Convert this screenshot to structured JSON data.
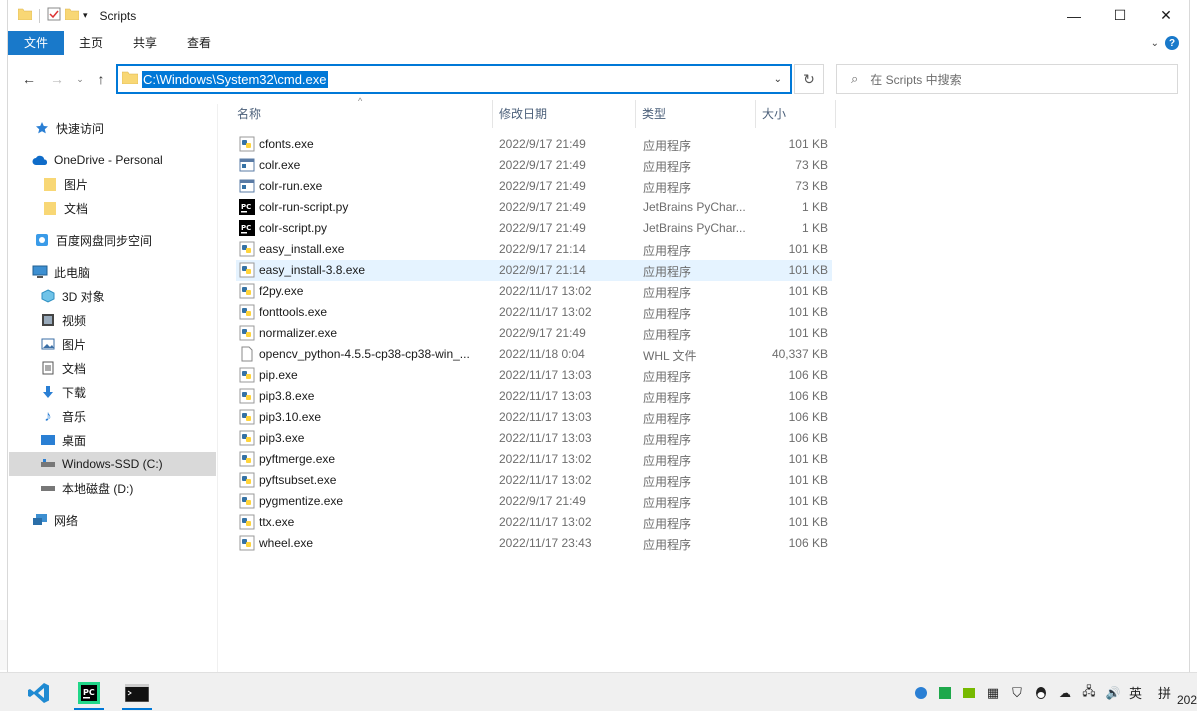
{
  "window": {
    "title": "Scripts",
    "controls": {
      "minimize": "—",
      "maximize": "☐",
      "close": "✕"
    }
  },
  "ribbon": {
    "tabs": [
      {
        "label": "文件",
        "active": true
      },
      {
        "label": "主页",
        "active": false
      },
      {
        "label": "共享",
        "active": false
      },
      {
        "label": "查看",
        "active": false
      }
    ],
    "help": "?"
  },
  "navigation": {
    "address": "C:\\Windows\\System32\\cmd.exe",
    "search_placeholder": "在 Scripts 中搜索"
  },
  "sidebar": {
    "items": [
      {
        "label": "快速访问",
        "icon": "star-icon"
      },
      {
        "label": "OneDrive - Personal",
        "icon": "cloud-icon"
      },
      {
        "label": "图片",
        "icon": "folder-icon"
      },
      {
        "label": "文档",
        "icon": "folder-icon"
      },
      {
        "label": "百度网盘同步空间",
        "icon": "baidu-netdisk-icon"
      },
      {
        "label": "此电脑",
        "icon": "computer-icon"
      },
      {
        "label": "3D 对象",
        "icon": "cube-icon"
      },
      {
        "label": "视频",
        "icon": "video-icon"
      },
      {
        "label": "图片",
        "icon": "pictures-icon"
      },
      {
        "label": "文档",
        "icon": "document-icon"
      },
      {
        "label": "下载",
        "icon": "download-icon"
      },
      {
        "label": "音乐",
        "icon": "music-icon"
      },
      {
        "label": "桌面",
        "icon": "desktop-icon"
      },
      {
        "label": "Windows-SSD (C:)",
        "icon": "drive-icon",
        "selected": true
      },
      {
        "label": "本地磁盘 (D:)",
        "icon": "drive-icon"
      },
      {
        "label": "网络",
        "icon": "network-icon"
      }
    ]
  },
  "columns": {
    "name": "名称",
    "modified": "修改日期",
    "type": "类型",
    "size": "大小"
  },
  "files": [
    {
      "name": "cfonts.exe",
      "modified": "2022/9/17 21:49",
      "type": "应用程序",
      "size": "101 KB",
      "icon": "python-exe-icon"
    },
    {
      "name": "colr.exe",
      "modified": "2022/9/17 21:49",
      "type": "应用程序",
      "size": "73 KB",
      "icon": "exe-icon"
    },
    {
      "name": "colr-run.exe",
      "modified": "2022/9/17 21:49",
      "type": "应用程序",
      "size": "73 KB",
      "icon": "exe-icon"
    },
    {
      "name": "colr-run-script.py",
      "modified": "2022/9/17 21:49",
      "type": "JetBrains PyChar...",
      "size": "1 KB",
      "icon": "pycharm-file-icon"
    },
    {
      "name": "colr-script.py",
      "modified": "2022/9/17 21:49",
      "type": "JetBrains PyChar...",
      "size": "1 KB",
      "icon": "pycharm-file-icon"
    },
    {
      "name": "easy_install.exe",
      "modified": "2022/9/17 21:14",
      "type": "应用程序",
      "size": "101 KB",
      "icon": "python-exe-icon"
    },
    {
      "name": "easy_install-3.8.exe",
      "modified": "2022/9/17 21:14",
      "type": "应用程序",
      "size": "101 KB",
      "icon": "python-exe-icon",
      "hover": true
    },
    {
      "name": "f2py.exe",
      "modified": "2022/11/17 13:02",
      "type": "应用程序",
      "size": "101 KB",
      "icon": "python-exe-icon"
    },
    {
      "name": "fonttools.exe",
      "modified": "2022/11/17 13:02",
      "type": "应用程序",
      "size": "101 KB",
      "icon": "python-exe-icon"
    },
    {
      "name": "normalizer.exe",
      "modified": "2022/9/17 21:49",
      "type": "应用程序",
      "size": "101 KB",
      "icon": "python-exe-icon"
    },
    {
      "name": "opencv_python-4.5.5-cp38-cp38-win_...",
      "modified": "2022/11/18 0:04",
      "type": "WHL 文件",
      "size": "40,337 KB",
      "icon": "blank-file-icon"
    },
    {
      "name": "pip.exe",
      "modified": "2022/11/17 13:03",
      "type": "应用程序",
      "size": "106 KB",
      "icon": "python-exe-icon"
    },
    {
      "name": "pip3.8.exe",
      "modified": "2022/11/17 13:03",
      "type": "应用程序",
      "size": "106 KB",
      "icon": "python-exe-icon"
    },
    {
      "name": "pip3.10.exe",
      "modified": "2022/11/17 13:03",
      "type": "应用程序",
      "size": "106 KB",
      "icon": "python-exe-icon"
    },
    {
      "name": "pip3.exe",
      "modified": "2022/11/17 13:03",
      "type": "应用程序",
      "size": "106 KB",
      "icon": "python-exe-icon"
    },
    {
      "name": "pyftmerge.exe",
      "modified": "2022/11/17 13:02",
      "type": "应用程序",
      "size": "101 KB",
      "icon": "python-exe-icon"
    },
    {
      "name": "pyftsubset.exe",
      "modified": "2022/11/17 13:02",
      "type": "应用程序",
      "size": "101 KB",
      "icon": "python-exe-icon"
    },
    {
      "name": "pygmentize.exe",
      "modified": "2022/9/17 21:49",
      "type": "应用程序",
      "size": "101 KB",
      "icon": "python-exe-icon"
    },
    {
      "name": "ttx.exe",
      "modified": "2022/11/17 13:02",
      "type": "应用程序",
      "size": "101 KB",
      "icon": "python-exe-icon"
    },
    {
      "name": "wheel.exe",
      "modified": "2022/11/17 23:43",
      "type": "应用程序",
      "size": "106 KB",
      "icon": "python-exe-icon"
    }
  ],
  "taskbar": {
    "apps": [
      "vscode-icon",
      "pycharm-icon",
      "terminal-icon"
    ],
    "tray_ime_lang": "英",
    "tray_ime_mode": "拼",
    "clock_partial": "202"
  },
  "colors": {
    "accent": "#0078d7",
    "ribbon_active": "#1979ca",
    "selected_nav": "#d9d9d9",
    "hover_row": "#e5f3ff"
  }
}
